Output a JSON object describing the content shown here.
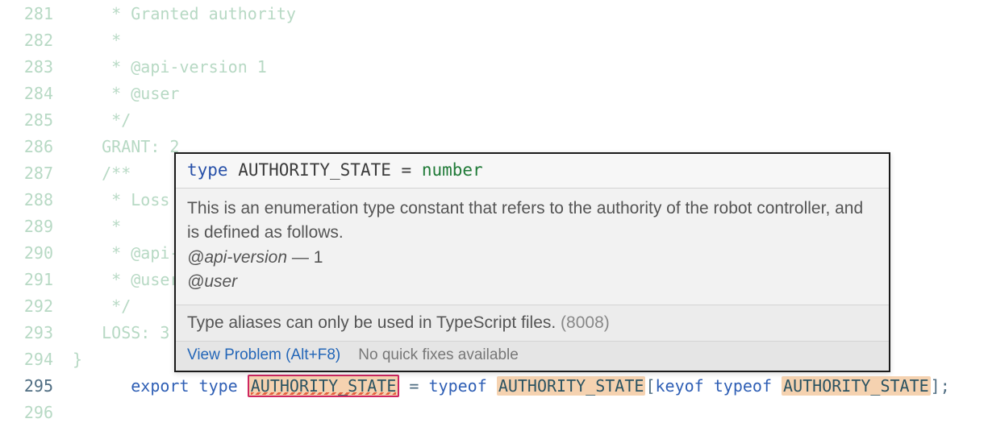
{
  "lines": {
    "281": {
      "num": "281",
      "text": "    * Granted authority"
    },
    "282": {
      "num": "282",
      "text": "    *"
    },
    "283": {
      "num": "283",
      "text": "    * @api-version 1"
    },
    "284": {
      "num": "284",
      "text": "    * @user"
    },
    "285": {
      "num": "285",
      "text": "    */"
    },
    "286": {
      "num": "286",
      "text": "   GRANT: 2"
    },
    "287": {
      "num": "287",
      "text": "   /**"
    },
    "288": {
      "num": "288",
      "text": "    * Loss au"
    },
    "289": {
      "num": "289",
      "text": "    *"
    },
    "290": {
      "num": "290",
      "text": "    * @api-v"
    },
    "291": {
      "num": "291",
      "text": "    * @user"
    },
    "292": {
      "num": "292",
      "text": "    */"
    },
    "293": {
      "num": "293",
      "text": "   LOSS: 3"
    },
    "294": {
      "num": "294",
      "text": "}"
    },
    "295": {
      "num": "295",
      "kw_export": "export",
      "kw_type": "type",
      "tok1": "AUTHORITY_STATE",
      "eq": " = ",
      "kw_typeof1": "typeof",
      "tok2": "AUTHORITY_STATE",
      "lbr": "[",
      "kw_keyof": "keyof",
      "kw_typeof2": "typeof",
      "tok3": "AUTHORITY_STATE",
      "rbr_semi": "];"
    },
    "296": {
      "num": "296",
      "text": ""
    }
  },
  "popup": {
    "sig": {
      "kw": "type",
      "name": " AUTHORITY_STATE ",
      "eq": "= ",
      "type": "number"
    },
    "doc_text": "This is an enumeration type constant that refers to the authority of the robot controller, and is defined as follows.",
    "doc_tag1": "@api-version",
    "doc_tag1_val": " — 1",
    "doc_tag2": "@user",
    "diag_text": "Type aliases can only be used in TypeScript files. ",
    "diag_code": "(8008)",
    "link_text": "View Problem (Alt+F8)",
    "nofix_text": "No quick fixes available"
  }
}
